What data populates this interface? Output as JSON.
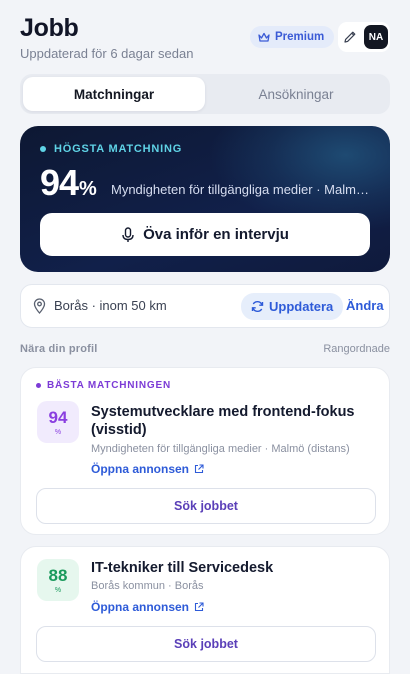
{
  "header": {
    "title": "Jobb",
    "subtitle": "Uppdaterad för 6 dagar sedan",
    "premium_label": "Premium",
    "avatar_initials": "NA"
  },
  "tabs": [
    {
      "label": "Matchningar",
      "active": true
    },
    {
      "label": "Ansökningar",
      "active": false
    }
  ],
  "hero": {
    "label": "HÖGSTA MATCHNING",
    "score": "94",
    "score_unit": "%",
    "employer": "Myndigheten för tillgängliga medier · Malmö (distans)",
    "button_label": "Öva inför en intervju"
  },
  "location": {
    "text": "Borås · inom 50 km",
    "update_label": "Uppdatera",
    "change_label": "Ändra"
  },
  "section": {
    "left": "Nära din profil",
    "right": "Rangordnade"
  },
  "jobs": [
    {
      "badge": "BÄSTA MATCHNINGEN",
      "score": "94",
      "score_unit": "%",
      "title": "Systemutvecklare med frontend-fokus (visstid)",
      "meta": "Myndigheten för tillgängliga medier · Malmö (distans)",
      "open_label": "Öppna annonsen",
      "apply_label": "Sök jobbet"
    },
    {
      "score": "88",
      "score_unit": "%",
      "title": "IT-tekniker till Servicedesk",
      "meta": "Borås kommun · Borås",
      "open_label": "Öppna annonsen",
      "apply_label": "Sök jobbet"
    }
  ],
  "colors": {
    "accent_blue": "#2e5bd8",
    "hero_dark": "#0d1833",
    "hero_cyan": "#5fd3e6",
    "best_purple": "#7c3bd6",
    "score_green": "#1a9a5c"
  },
  "icons": [
    "crown-icon",
    "pencil-icon",
    "microphone-icon",
    "location-pin-icon",
    "refresh-icon",
    "external-link-icon"
  ]
}
